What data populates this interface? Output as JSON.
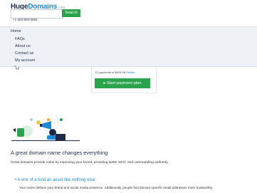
{
  "header": {
    "logo_main": "Huge",
    "logo_accent": "Domains",
    "logo_suffix": ".com",
    "search_placeholder": "",
    "search_label": "Search",
    "phone": "+1-303-893-0552"
  },
  "menu": {
    "items": [
      {
        "label": "Home"
      },
      {
        "label": "FAQs"
      },
      {
        "label": "About us"
      },
      {
        "label": "Contact us"
      },
      {
        "label": "My account"
      }
    ],
    "cart_icon": "cart-icon"
  },
  "payment": {
    "summary": "12 payments of $824.58",
    "details_link": "Details",
    "button_label": "▸ Start payment plan"
  },
  "content": {
    "heading": "A great domain name changes everything",
    "intro": "Great domains provide value by improving your brand, providing better SEO, and commanding authority.",
    "bullet_title": "A one of a kind an asset like nothing else",
    "bullet_text": "Your name defines your brand and social media presence. Additionally, people find domain-specific email addresses more trustworthy."
  },
  "colors": {
    "accent": "#2ba24c",
    "link": "#1d8ad6",
    "navy": "#1d2b4a",
    "menu_bg": "#eef2f6"
  }
}
